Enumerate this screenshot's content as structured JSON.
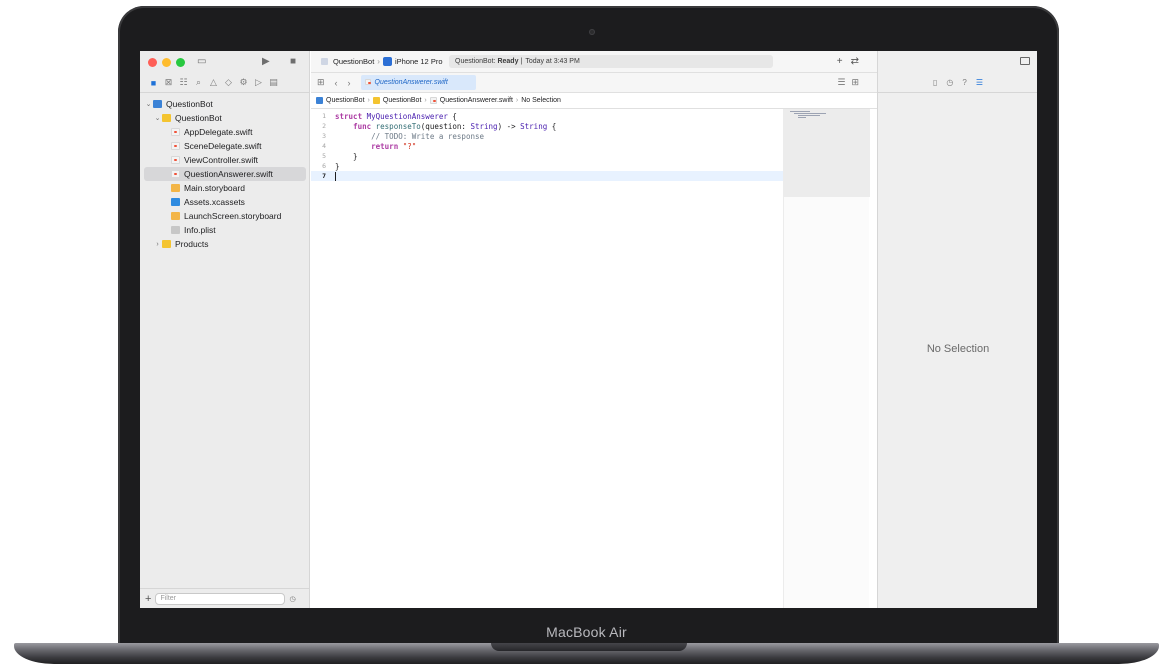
{
  "device": {
    "label": "MacBook Air"
  },
  "toolbar": {
    "scheme": "QuestionBot",
    "destination": "iPhone 12 Pro",
    "status_project": "QuestionBot:",
    "status_state": "Ready",
    "status_separator": "|",
    "status_time": "Today at 3:43 PM"
  },
  "navigator": {
    "tree": [
      {
        "label": "QuestionBot",
        "indent": 0,
        "kind": "project",
        "disclosure": "open"
      },
      {
        "label": "QuestionBot",
        "indent": 1,
        "kind": "folder",
        "disclosure": "open"
      },
      {
        "label": "AppDelegate.swift",
        "indent": 2,
        "kind": "swift",
        "disclosure": ""
      },
      {
        "label": "SceneDelegate.swift",
        "indent": 2,
        "kind": "swift",
        "disclosure": ""
      },
      {
        "label": "ViewController.swift",
        "indent": 2,
        "kind": "swift",
        "disclosure": ""
      },
      {
        "label": "QuestionAnswerer.swift",
        "indent": 2,
        "kind": "swift",
        "disclosure": "",
        "selected": true
      },
      {
        "label": "Main.storyboard",
        "indent": 2,
        "kind": "storyboard",
        "disclosure": ""
      },
      {
        "label": "Assets.xcassets",
        "indent": 2,
        "kind": "assets",
        "disclosure": ""
      },
      {
        "label": "LaunchScreen.storyboard",
        "indent": 2,
        "kind": "storyboard",
        "disclosure": ""
      },
      {
        "label": "Info.plist",
        "indent": 2,
        "kind": "plist",
        "disclosure": ""
      },
      {
        "label": "Products",
        "indent": 1,
        "kind": "folder",
        "disclosure": "closed"
      }
    ],
    "filter_placeholder": "Filter"
  },
  "editor": {
    "tab_label": "QuestionAnswerer.swift",
    "jump_bar": [
      "QuestionBot",
      "QuestionBot",
      "QuestionAnswerer.swift",
      "No Selection"
    ],
    "code_lines": [
      {
        "num": "1",
        "tokens": [
          {
            "t": "kw",
            "s": "struct"
          },
          {
            "t": "",
            "s": " "
          },
          {
            "t": "ty",
            "s": "MyQuestionAnswerer"
          },
          {
            "t": "",
            "s": " {"
          }
        ]
      },
      {
        "num": "2",
        "tokens": [
          {
            "t": "",
            "s": "    "
          },
          {
            "t": "kw",
            "s": "func"
          },
          {
            "t": "",
            "s": " "
          },
          {
            "t": "fn",
            "s": "responseTo"
          },
          {
            "t": "",
            "s": "(question: "
          },
          {
            "t": "ty",
            "s": "String"
          },
          {
            "t": "",
            "s": ") -> "
          },
          {
            "t": "ty",
            "s": "String"
          },
          {
            "t": "",
            "s": " {"
          }
        ]
      },
      {
        "num": "3",
        "tokens": [
          {
            "t": "",
            "s": "        "
          },
          {
            "t": "cm",
            "s": "// TODO: Write a response"
          }
        ]
      },
      {
        "num": "4",
        "tokens": [
          {
            "t": "",
            "s": "        "
          },
          {
            "t": "kw",
            "s": "return"
          },
          {
            "t": "",
            "s": " "
          },
          {
            "t": "st",
            "s": "\"?\""
          }
        ]
      },
      {
        "num": "5",
        "tokens": [
          {
            "t": "",
            "s": "    }"
          }
        ]
      },
      {
        "num": "6",
        "tokens": [
          {
            "t": "",
            "s": "}"
          }
        ]
      },
      {
        "num": "7",
        "tokens": [],
        "current": true
      }
    ]
  },
  "inspector": {
    "empty_label": "No Selection"
  },
  "colors": {
    "accent": "#1e72d8",
    "close": "#fe5f57",
    "minimize": "#febc2e",
    "zoom": "#28c840"
  }
}
